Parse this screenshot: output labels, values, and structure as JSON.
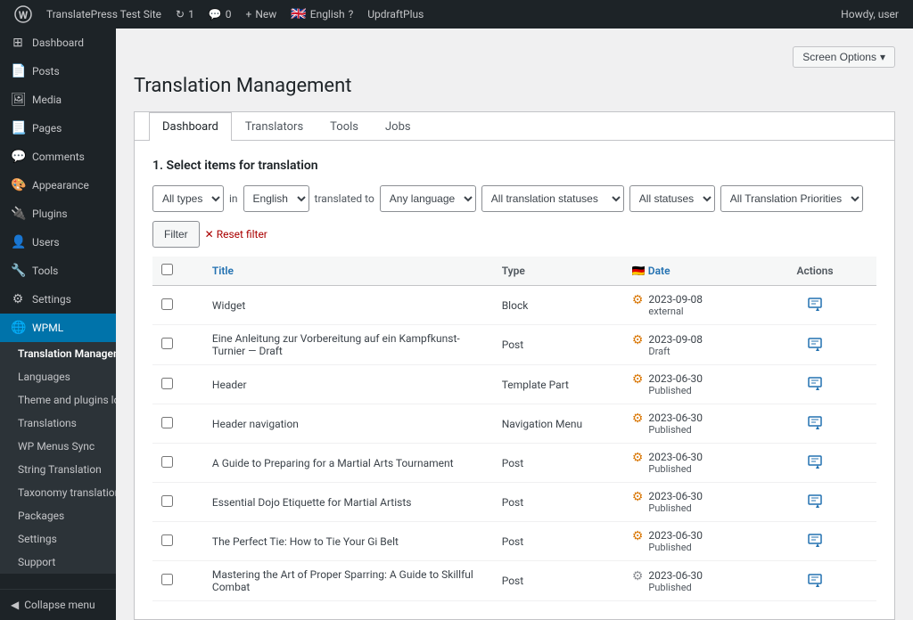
{
  "adminbar": {
    "site_name": "TranslatePress Test Site",
    "new_label": "New",
    "language": "English",
    "plugin": "UpdraftPlus",
    "howdy": "Howdy, user",
    "updates_count": "1",
    "comments_count": "0"
  },
  "sidebar": {
    "items": [
      {
        "label": "Dashboard",
        "icon": "⊞"
      },
      {
        "label": "Posts",
        "icon": "📄"
      },
      {
        "label": "Media",
        "icon": "🖼"
      },
      {
        "label": "Pages",
        "icon": "📃"
      },
      {
        "label": "Comments",
        "icon": "💬"
      },
      {
        "label": "Appearance",
        "icon": "🎨"
      },
      {
        "label": "Plugins",
        "icon": "🔌"
      },
      {
        "label": "Users",
        "icon": "👤"
      },
      {
        "label": "Tools",
        "icon": "🔧"
      },
      {
        "label": "Settings",
        "icon": "⚙"
      }
    ],
    "wpml_label": "WPML",
    "submenu": [
      {
        "label": "Translation Management",
        "active": true
      },
      {
        "label": "Languages"
      },
      {
        "label": "Theme and plugins localization"
      },
      {
        "label": "Translations"
      },
      {
        "label": "WP Menus Sync"
      },
      {
        "label": "String Translation"
      },
      {
        "label": "Taxonomy translation"
      },
      {
        "label": "Packages"
      },
      {
        "label": "Settings"
      },
      {
        "label": "Support"
      }
    ],
    "collapse_label": "Collapse menu"
  },
  "page": {
    "title": "Translation Management",
    "screen_options": "Screen Options"
  },
  "tabs": [
    {
      "label": "Dashboard",
      "active": true
    },
    {
      "label": "Translators"
    },
    {
      "label": "Tools"
    },
    {
      "label": "Jobs"
    }
  ],
  "filters": {
    "section_title": "1. Select items for translation",
    "type_options": [
      "All types"
    ],
    "in_label": "in",
    "language_options": [
      "English"
    ],
    "translated_to_label": "translated to",
    "any_language_options": [
      "Any language"
    ],
    "translation_status_options": [
      "All translation statuses"
    ],
    "all_statuses_options": [
      "All statuses"
    ],
    "priorities_options": [
      "All Translation Priorities"
    ],
    "filter_btn": "Filter",
    "reset_label": "Reset filter"
  },
  "table": {
    "columns": [
      {
        "label": "Title",
        "sortable": true
      },
      {
        "label": "Type"
      },
      {
        "label": "🇩🇪 Date",
        "sortable": true
      },
      {
        "label": "Actions"
      }
    ],
    "rows": [
      {
        "title": "Widget",
        "type": "Block",
        "status_icon": "⚙",
        "status_color": "orange",
        "date": "2023-09-08",
        "date_status": "external"
      },
      {
        "title": "Eine Anleitung zur Vorbereitung auf ein Kampfkunst-Turnier — Draft",
        "type": "Post",
        "status_icon": "⚙",
        "status_color": "orange",
        "date": "2023-09-08",
        "date_status": "Draft"
      },
      {
        "title": "Header",
        "type": "Template Part",
        "status_icon": "⚙",
        "status_color": "orange",
        "date": "2023-06-30",
        "date_status": "Published"
      },
      {
        "title": "Header navigation",
        "type": "Navigation Menu",
        "status_icon": "⚙",
        "status_color": "orange",
        "date": "2023-06-30",
        "date_status": "Published"
      },
      {
        "title": "A Guide to Preparing for a Martial Arts Tournament",
        "type": "Post",
        "status_icon": "⚙",
        "status_color": "orange",
        "date": "2023-06-30",
        "date_status": "Published"
      },
      {
        "title": "Essential Dojo Etiquette for Martial Artists",
        "type": "Post",
        "status_icon": "⚙",
        "status_color": "orange",
        "date": "2023-06-30",
        "date_status": "Published"
      },
      {
        "title": "The Perfect Tie: How to Tie Your Gi Belt",
        "type": "Post",
        "status_icon": "⚙",
        "status_color": "orange",
        "date": "2023-06-30",
        "date_status": "Published"
      },
      {
        "title": "Mastering the Art of Proper Sparring: A Guide to Skillful Combat",
        "type": "Post",
        "status_icon": "⚙",
        "status_color": "gray",
        "date": "2023-06-30",
        "date_status": "Published"
      }
    ]
  }
}
